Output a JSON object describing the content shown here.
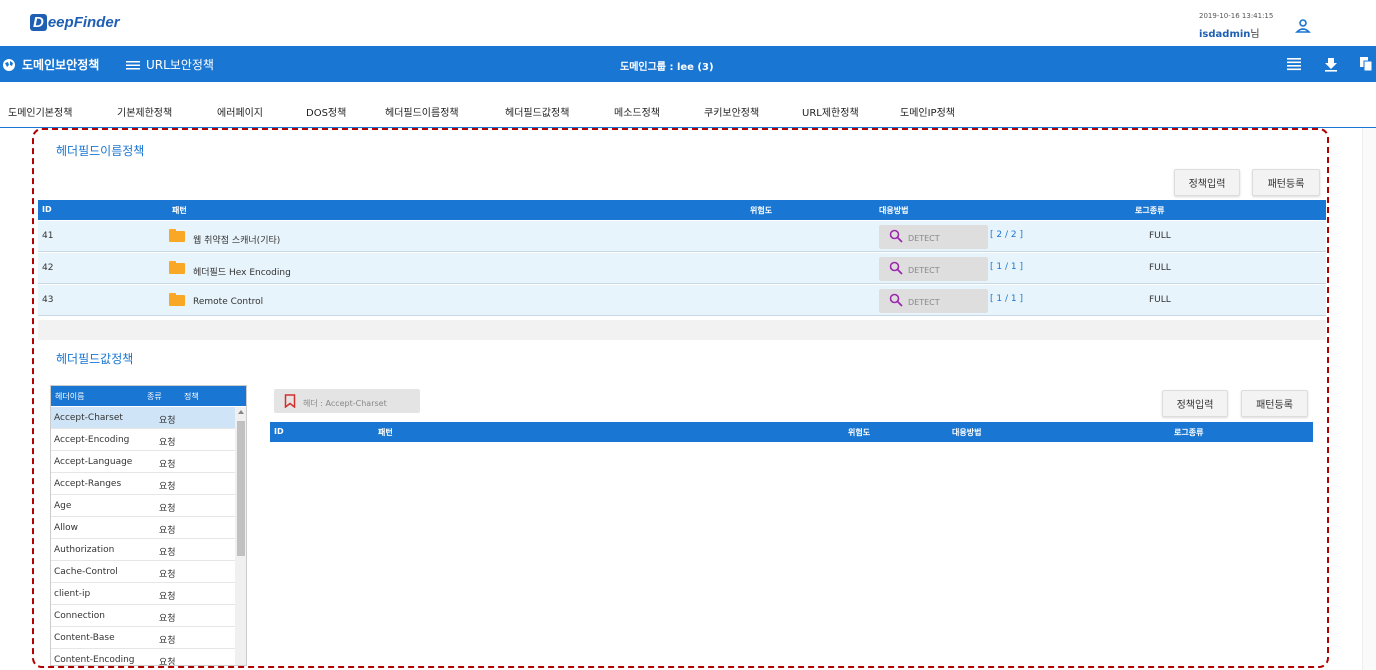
{
  "app": {
    "logo_mark": "D",
    "logo_rest": "eepFinder"
  },
  "header": {
    "timestamp": "2019-10-16 13:41:15",
    "username": "isdadmin",
    "user_suffix": "님"
  },
  "nav": {
    "domain_policy": "도메인보안정책",
    "url_policy": "URL보안정책",
    "group_label": "도메인그룹 : lee (3)"
  },
  "tabs": [
    "도메인기본정책",
    "기본제한정책",
    "에러페이지",
    "DOS정책",
    "헤더필드이름정책",
    "헤더필드값정책",
    "메소드정책",
    "쿠키보안정책",
    "URL제한정책",
    "도메인IP정책"
  ],
  "section1": {
    "title": "헤더필드이름정책",
    "btn_policy": "정책입력",
    "btn_pattern": "패턴등록",
    "columns": {
      "id": "ID",
      "pattern": "패턴",
      "risk": "위험도",
      "action": "대응방법",
      "log": "로그종류"
    },
    "rows": [
      {
        "id": "41",
        "pattern": "웹 취약점 스캐너(기타)",
        "action": "DETECT",
        "ratio": "[  2 / 2  ]",
        "log": "FULL"
      },
      {
        "id": "42",
        "pattern": "헤더필드 Hex Encoding",
        "action": "DETECT",
        "ratio": "[  1 / 1  ]",
        "log": "FULL"
      },
      {
        "id": "43",
        "pattern": "Remote Control",
        "action": "DETECT",
        "ratio": "[  1 / 1  ]",
        "log": "FULL"
      }
    ]
  },
  "section2": {
    "title": "헤더필드값정책",
    "list_columns": {
      "name": "헤더이름",
      "kind": "종류",
      "policy": "정책"
    },
    "headers": [
      {
        "name": "Accept-Charset",
        "kind": "요청"
      },
      {
        "name": "Accept-Encoding",
        "kind": "요청"
      },
      {
        "name": "Accept-Language",
        "kind": "요청"
      },
      {
        "name": "Accept-Ranges",
        "kind": "요청"
      },
      {
        "name": "Age",
        "kind": "요청"
      },
      {
        "name": "Allow",
        "kind": "요청"
      },
      {
        "name": "Authorization",
        "kind": "요청"
      },
      {
        "name": "Cache-Control",
        "kind": "요청"
      },
      {
        "name": "client-ip",
        "kind": "요청"
      },
      {
        "name": "Connection",
        "kind": "요청"
      },
      {
        "name": "Content-Base",
        "kind": "요청"
      },
      {
        "name": "Content-Encoding",
        "kind": "요청"
      }
    ],
    "filter_label": "헤더 : Accept-Charset",
    "btn_policy": "정책입력",
    "btn_pattern": "패턴등록",
    "columns": {
      "id": "ID",
      "pattern": "패턴",
      "risk": "위험도",
      "action": "대응방법",
      "log": "로그종류"
    }
  },
  "colors": {
    "primary": "#1976d2",
    "annotation": "#b00000",
    "folder": "#f9a825",
    "row_bg": "#e8f4fb"
  }
}
